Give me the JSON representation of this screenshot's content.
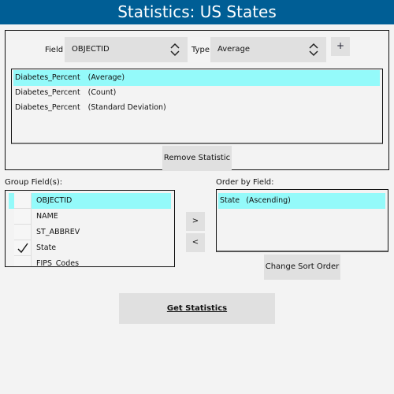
{
  "title": "Statistics: US States",
  "statistics": {
    "field_label": "Field",
    "field_value": "OBJECTID",
    "type_label": "Type",
    "type_value": "Average",
    "add_label": "+",
    "items": [
      {
        "field": "Diabetes_Percent",
        "stat": "(Average)",
        "selected": true
      },
      {
        "field": "Diabetes_Percent",
        "stat": "(Count)",
        "selected": false
      },
      {
        "field": "Diabetes_Percent",
        "stat": "(Standard Deviation)",
        "selected": false
      }
    ],
    "remove_label": "Remove Statistic"
  },
  "group": {
    "label": "Group Field(s):",
    "items": [
      {
        "name": "OBJECTID",
        "checked": false,
        "selected": true
      },
      {
        "name": "NAME",
        "checked": false,
        "selected": false
      },
      {
        "name": "ST_ABBREV",
        "checked": false,
        "selected": false
      },
      {
        "name": "State",
        "checked": true,
        "selected": false
      },
      {
        "name": "FIPS_Codes",
        "checked": false,
        "selected": false
      }
    ]
  },
  "move": {
    "add_label": ">",
    "remove_label": "<"
  },
  "order": {
    "label": "Order by Field:",
    "items": [
      {
        "field": "State",
        "direction": "(Ascending)",
        "selected": true
      }
    ],
    "change_label": "Change Sort Order"
  },
  "get_statistics_label": "Get Statistics",
  "colors": {
    "title_bar": "#005e95",
    "selection": "#94fafa",
    "button": "#e0e0e0",
    "background": "#f3f3f3"
  }
}
